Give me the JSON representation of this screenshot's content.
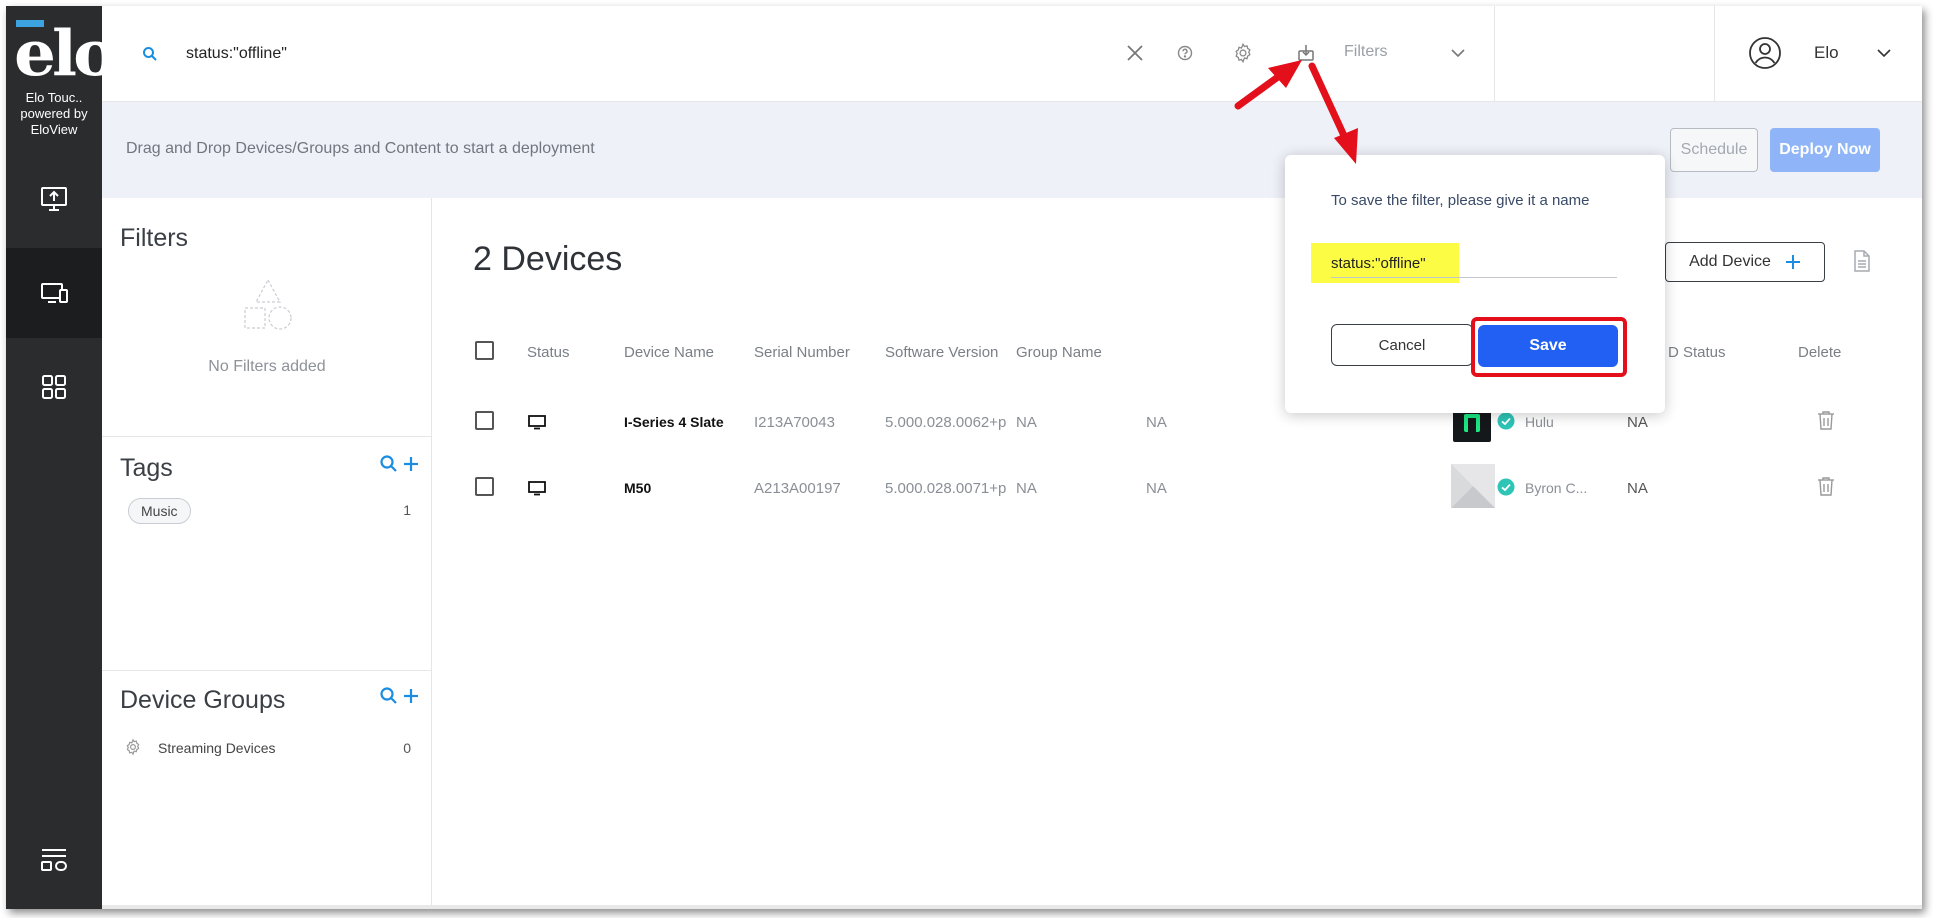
{
  "brand": {
    "logo_text": "elo",
    "caption": "Elo Touc..\npowered by\nEloView"
  },
  "search": {
    "value": "status:\"offline\"",
    "placeholder": ""
  },
  "topbar": {
    "filters_label": "Filters",
    "user_name": "Elo"
  },
  "banner": {
    "text": "Drag and Drop Devices/Groups and Content to start a deployment",
    "schedule_label": "Schedule",
    "deploy_label": "Deploy Now"
  },
  "filters_panel": {
    "title": "Filters",
    "empty_text": "No Filters added"
  },
  "tags_panel": {
    "title": "Tags",
    "items": [
      {
        "label": "Music",
        "count": "1"
      }
    ]
  },
  "groups_panel": {
    "title": "Device Groups",
    "items": [
      {
        "label": "Streaming Devices",
        "count": "0"
      }
    ]
  },
  "main": {
    "title": "2 Devices",
    "add_device_label": "Add Device",
    "columns": [
      "Status",
      "Device Name",
      "Serial Number",
      "Software Version",
      "Group Name",
      "D Status",
      "Delete"
    ],
    "rows": [
      {
        "device_name": "I-Series 4 Slate",
        "serial": "I213A70043",
        "software": "5.000.028.0062+p",
        "group": "NA",
        "col6": "NA",
        "content": "Hulu",
        "status": "NA"
      },
      {
        "device_name": "M50",
        "serial": "A213A00197",
        "software": "5.000.028.0071+p",
        "group": "NA",
        "col6": "NA",
        "content": "Byron C...",
        "status": "NA"
      }
    ]
  },
  "popup": {
    "message": "To save the filter, please give it a name",
    "input_value": "status:\"offline\"",
    "cancel_label": "Cancel",
    "save_label": "Save"
  },
  "colors": {
    "accent": "#2160f3",
    "highlight": "#fcfc45",
    "annotation_red": "#e3101b",
    "rail_bg": "#2b2c2e",
    "link_blue": "#1a8de0"
  }
}
